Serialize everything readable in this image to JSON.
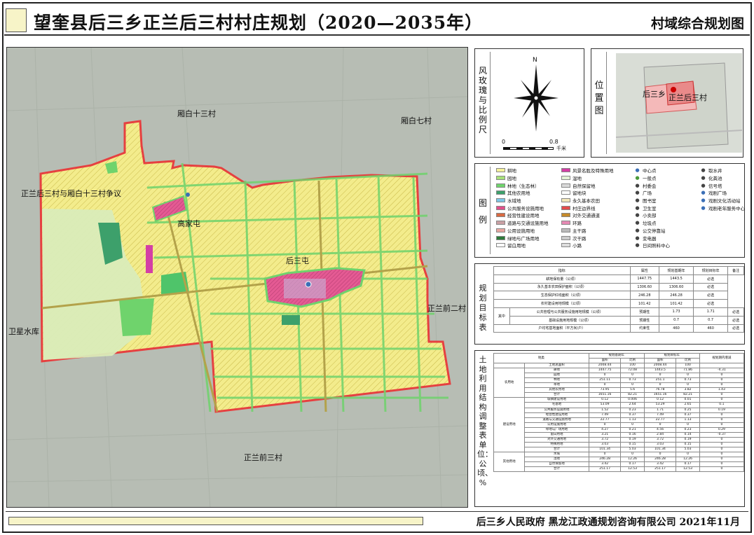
{
  "header": {
    "title": "望奎县后三乡正兰后三村村庄规划（2020—2035年）",
    "subtitle": "村域综合规划图"
  },
  "map": {
    "labels": {
      "n13": "厢白十三村",
      "n7": "厢白七村",
      "dispute": "正兰后三村与厢白十三村争议",
      "gaojiatun": "高家屯",
      "housantun": "后三屯",
      "zhenglanqian2": "正兰前二村",
      "weixing": "卫星水库",
      "zhenglanqian3": "正兰前三村"
    }
  },
  "compass": {
    "title": "风玫瑰与比例尺",
    "north": "N",
    "scale_start": "0",
    "scale_end": "0.8",
    "scale_unit": "千米"
  },
  "location": {
    "title": "位置图",
    "houSan": "后三乡",
    "village": "正兰后三村"
  },
  "legend": {
    "title": "图例",
    "items": [
      {
        "label": "耕地",
        "color": "#f5f19a"
      },
      {
        "label": "园地",
        "color": "#a6e07a"
      },
      {
        "label": "林地（生态林）",
        "color": "#6fd36c"
      },
      {
        "label": "其他农用地",
        "color": "#3da06b"
      },
      {
        "label": "水域地",
        "color": "#7cc6e6"
      },
      {
        "label": "公共服务设施用地",
        "color": "#e0508a"
      },
      {
        "label": "经营性建设用地",
        "color": "#d86a42"
      },
      {
        "label": "道路与交通设施用地",
        "color": "#c9a0a4"
      },
      {
        "label": "公用设施用地",
        "color": "#e9a6a0"
      },
      {
        "label": "绿地与广场用地",
        "color": "#2e7a3a"
      },
      {
        "label": "留白用地",
        "color": "#ffffff"
      },
      {
        "label": "风景名胜及特殊用地",
        "color": "#d43fa5"
      },
      {
        "label": "湿地",
        "color": "#e3f2d6"
      },
      {
        "label": "自然保留地",
        "color": "#d9d9d9"
      },
      {
        "label": "留地块",
        "color": "#ffffff"
      },
      {
        "label": "永久基本农田",
        "color": "#f2e6b8"
      },
      {
        "label": "村庄边界线",
        "color": "#e34b4b"
      },
      {
        "label": "对外交通通道",
        "color": "#c58a2b"
      },
      {
        "label": "环路",
        "color": "#e58ab4"
      },
      {
        "label": "主干路",
        "color": "#bbbbbb"
      },
      {
        "label": "次干路",
        "color": "#cccccc"
      },
      {
        "label": "小路",
        "color": "#dddddd"
      },
      {
        "label": "中心点",
        "color": "#3b6fb6"
      },
      {
        "label": "一般点",
        "color": "#4a9a3a"
      },
      {
        "label": "村委会",
        "color": "#444444"
      },
      {
        "label": "广场",
        "color": "#444444"
      },
      {
        "label": "图书室",
        "color": "#444444"
      },
      {
        "label": "卫生室",
        "color": "#444444"
      },
      {
        "label": "小卖部",
        "color": "#444444"
      },
      {
        "label": "垃圾点",
        "color": "#444444"
      },
      {
        "label": "公交停靠站",
        "color": "#444444"
      },
      {
        "label": "变电器",
        "color": "#444444"
      },
      {
        "label": "日间照料中心",
        "color": "#444444"
      },
      {
        "label": "取水井",
        "color": "#444444"
      },
      {
        "label": "化粪池",
        "color": "#444444"
      },
      {
        "label": "信号塔",
        "color": "#444444"
      },
      {
        "label": "戏剧广场",
        "color": "#3b6fb6"
      },
      {
        "label": "戏剧文化活动站",
        "color": "#3b6fb6"
      },
      {
        "label": "戏剧老年服务中心",
        "color": "#3b6fb6"
      },
      {
        "label": "戏剧公厕",
        "color": "#3b6fb6"
      }
    ]
  },
  "goals": {
    "title": "规划目标表",
    "headers": [
      "指标",
      "属性",
      "规划基期年",
      "规划目标年",
      "备注"
    ],
    "rows": [
      [
        "耕地保有量（公顷）",
        "约束性",
        "1447.75",
        "1443.5",
        "必选"
      ],
      [
        "永久基本农田保护面积（公顷）",
        "约束性",
        "1306.60",
        "1306.60",
        "必选"
      ],
      [
        "生态保护红线面积（公顷）",
        "约束性",
        "246.28",
        "246.28",
        "必选"
      ],
      [
        "农村建设用地规模（公顷）",
        "约束性",
        "101.42",
        "101.42",
        "必选"
      ],
      [
        "其中",
        "公共管理与公共服务设施用地规模（公顷）",
        "预期性",
        "1.73",
        "1.71",
        "必选"
      ],
      [
        "",
        "基础设施用地规模（公顷）",
        "预期性",
        "0.7",
        "0.7",
        "必选"
      ],
      [
        "户均宅基地面积（平方米/户）",
        "",
        "约束性",
        "460",
        "460",
        "必选"
      ]
    ]
  },
  "land": {
    "title": "土地利用结构调整表",
    "unit_label": "单位：公顷、%",
    "headers1": [
      "地类",
      "规划基期年",
      "规划目标年",
      "规划期内增减"
    ],
    "headers2": [
      "面积",
      "比例",
      "面积",
      "比例"
    ],
    "rows": [
      [
        "",
        "土地总面积",
        "2008.44",
        "100",
        "2008.44",
        "100",
        ""
      ],
      [
        "农用地",
        "耕地",
        "1447.75",
        "72.08",
        "1443.5",
        "71.86",
        "-4.31"
      ],
      [
        "",
        "园地",
        "0",
        "0",
        "0",
        "0",
        "0"
      ],
      [
        "",
        "林地",
        "251.11",
        "0.73",
        "251.1",
        "0.73",
        "0"
      ],
      [
        "",
        "草地",
        "0",
        "0",
        "0",
        "0",
        "0"
      ],
      [
        "",
        "其他农用地",
        "73.95",
        "5.6",
        "76.78",
        "3.82",
        "1.43"
      ],
      [
        "",
        "合计",
        "1651.16",
        "82.21",
        "1651.16",
        "82.21",
        "0"
      ],
      [
        "建设用地",
        "城镇建设用地",
        "0.12",
        "0.006",
        "0.12",
        "0.01",
        "0"
      ],
      [
        "",
        "宅基地",
        "53.09",
        "2.64",
        "53.29",
        "2.65",
        "0.1"
      ],
      [
        "",
        "公共服务设施用地",
        "1.52",
        "0.23",
        "1.71",
        "0.25",
        "0.19"
      ],
      [
        "",
        "经营性建设用地",
        "7.49",
        "0.37",
        "7.49",
        "0.37",
        "0"
      ],
      [
        "",
        "道路与交通设施用地",
        "22.77",
        "1.13",
        "22.77",
        "1.13",
        "0"
      ],
      [
        "",
        "公用设施用地",
        "0",
        "0",
        "0",
        "0",
        "0"
      ],
      [
        "",
        "绿地与广场用地",
        "4.27",
        "0.21",
        "4.56",
        "0.23",
        "0.29"
      ],
      [
        "",
        "留白用地",
        "3.21",
        "0.16",
        "2.84",
        "0.14",
        "-0.37"
      ],
      [
        "",
        "对外交通用地",
        "3.72",
        "0.19",
        "3.72",
        "0.19",
        "0"
      ],
      [
        "",
        "特殊用地",
        "3.03",
        "0.15",
        "3.03",
        "0.15",
        "0"
      ],
      [
        "",
        "合计",
        "101.34",
        "5.03",
        "101.34",
        "5.03",
        "0"
      ],
      [
        "其他用地",
        "水域",
        "0",
        "0",
        "0",
        "0",
        "0"
      ],
      [
        "",
        "湿地",
        "246.28",
        "12.26",
        "246.28",
        "12.26",
        "0"
      ],
      [
        "",
        "自然保留地",
        "3.42",
        "0.17",
        "3.42",
        "0.17",
        "0"
      ],
      [
        "",
        "合计",
        "251.17",
        "12.53",
        "251.17",
        "12.53",
        "0"
      ]
    ]
  },
  "footer": {
    "text": "后三乡人民政府  黑龙江政通规划咨询有限公司  2021年11月"
  }
}
